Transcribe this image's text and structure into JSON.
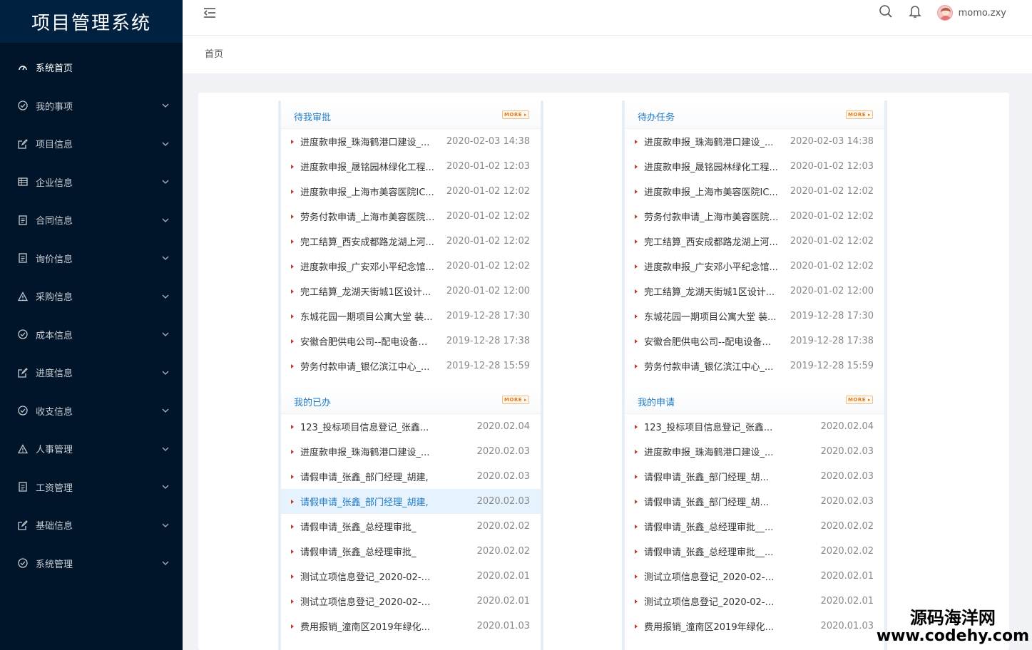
{
  "app": {
    "title": "项目管理系统"
  },
  "sidebar": {
    "items": [
      {
        "label": "系统首页",
        "icon": "dashboard-icon",
        "active": true,
        "arrow": false
      },
      {
        "label": "我的事项",
        "icon": "check-circle-icon",
        "arrow": true
      },
      {
        "label": "项目信息",
        "icon": "edit-icon",
        "arrow": true
      },
      {
        "label": "企业信息",
        "icon": "table-icon",
        "arrow": true
      },
      {
        "label": "合同信息",
        "icon": "document-icon",
        "arrow": true
      },
      {
        "label": "询价信息",
        "icon": "document-icon",
        "arrow": true
      },
      {
        "label": "采购信息",
        "icon": "warning-icon",
        "arrow": true
      },
      {
        "label": "成本信息",
        "icon": "check-circle-icon",
        "arrow": true
      },
      {
        "label": "进度信息",
        "icon": "edit-icon",
        "arrow": true
      },
      {
        "label": "收支信息",
        "icon": "check-circle-icon",
        "arrow": true
      },
      {
        "label": "人事管理",
        "icon": "warning-icon",
        "arrow": true
      },
      {
        "label": "工资管理",
        "icon": "document-icon",
        "arrow": true
      },
      {
        "label": "基础信息",
        "icon": "edit-icon",
        "arrow": true
      },
      {
        "label": "系统管理",
        "icon": "check-circle-icon",
        "arrow": true
      }
    ]
  },
  "header": {
    "username": "momo.zxy"
  },
  "breadcrumb": {
    "current": "首页"
  },
  "more_label": "MORE",
  "panels": {
    "pending_approval": {
      "title": "待我审批",
      "rows": [
        {
          "text": "进度款申报_珠海鹤港口建设_...",
          "date": "2020-02-03 14:38"
        },
        {
          "text": "进度款申报_晟铭园林绿化工程...",
          "date": "2020-01-02 12:03"
        },
        {
          "text": "进度款申报_上海市美容医院IC...",
          "date": "2020-01-02 12:02"
        },
        {
          "text": "劳务付款申请_上海市美容医院I...",
          "date": "2020-01-02 12:02"
        },
        {
          "text": "完工结算_西安成都路龙湖上河...",
          "date": "2020-01-02 12:02"
        },
        {
          "text": "进度款申报_广安邓小平纪念馆...",
          "date": "2020-01-02 12:02"
        },
        {
          "text": "完工结算_龙湖天街城1区设计...",
          "date": "2020-01-02 12:00"
        },
        {
          "text": "东城花园一期项目公寓大堂 装...",
          "date": "2019-12-28 17:30"
        },
        {
          "text": "安徽合肥供电公司--配电设备检...",
          "date": "2019-12-28 17:38"
        },
        {
          "text": "劳务付款申请_银亿滨江中心_...",
          "date": "2019-12-28 15:59"
        }
      ]
    },
    "todo_tasks": {
      "title": "待办任务",
      "rows": [
        {
          "text": "进度款申报_珠海鹤港口建设_...",
          "date": "2020-02-03 14:38"
        },
        {
          "text": "进度款申报_晟铭园林绿化工程...",
          "date": "2020-01-02 12:03"
        },
        {
          "text": "进度款申报_上海市美容医院IC...",
          "date": "2020-01-02 12:02"
        },
        {
          "text": "劳务付款申请_上海市美容医院I...",
          "date": "2020-01-02 12:02"
        },
        {
          "text": "完工结算_西安成都路龙湖上河...",
          "date": "2020-01-02 12:02"
        },
        {
          "text": "进度款申报_广安邓小平纪念馆...",
          "date": "2020-01-02 12:02"
        },
        {
          "text": "完工结算_龙湖天街城1区设计...",
          "date": "2020-01-02 12:00"
        },
        {
          "text": "东城花园一期项目公寓大堂 装...",
          "date": "2019-12-28 17:30"
        },
        {
          "text": "安徽合肥供电公司--配电设备检...",
          "date": "2019-12-28 17:38"
        },
        {
          "text": "劳务付款申请_银亿滨江中心_...",
          "date": "2019-12-28 15:59"
        }
      ]
    },
    "my_done": {
      "title": "我的已办",
      "rows": [
        {
          "text": "123_投标项目信息登记_张鑫...",
          "date": "2020.02.04"
        },
        {
          "text": "进度款申报_珠海鹤港口建设_...",
          "date": "2020.02.03"
        },
        {
          "text": "请假申请_张鑫_部门经理_胡建,",
          "date": "2020.02.03"
        },
        {
          "text": "请假申请_张鑫_部门经理_胡建,",
          "date": "2020.02.03",
          "highlight": true
        },
        {
          "text": "请假申请_张鑫_总经理审批_",
          "date": "2020.02.02"
        },
        {
          "text": "请假申请_张鑫_总经理审批_",
          "date": "2020.02.02"
        },
        {
          "text": "测试立项信息登记_2020-02-0...",
          "date": "2020.02.01"
        },
        {
          "text": "测试立项信息登记_2020-02-0...",
          "date": "2020.02.01"
        },
        {
          "text": "费用报销_潼南区2019年绿化...",
          "date": "2020.01.03"
        }
      ]
    },
    "my_applications": {
      "title": "我的申请",
      "rows": [
        {
          "text": "123_投标项目信息登记_张鑫...",
          "date": "2020.02.04"
        },
        {
          "text": "进度款申报_珠海鹤港口建设_...",
          "date": "2020.02.03"
        },
        {
          "text": "请假申请_张鑫_部门经理_胡...",
          "date": "2020.02.03"
        },
        {
          "text": "请假申请_张鑫_部门经理_胡...",
          "date": "2020.02.03"
        },
        {
          "text": "请假申请_张鑫_总经理审批__...",
          "date": "2020.02.02"
        },
        {
          "text": "请假申请_张鑫_总经理审批__...",
          "date": "2020.02.02"
        },
        {
          "text": "测试立项信息登记_2020-02-0...",
          "date": "2020.02.01"
        },
        {
          "text": "测试立项信息登记_2020-02-0...",
          "date": "2020.02.01"
        },
        {
          "text": "费用报销_潼南区2019年绿化...",
          "date": "2020.01.03"
        }
      ]
    }
  },
  "watermark": {
    "line1": "源码海洋网",
    "line2": "www.codehy.com"
  }
}
